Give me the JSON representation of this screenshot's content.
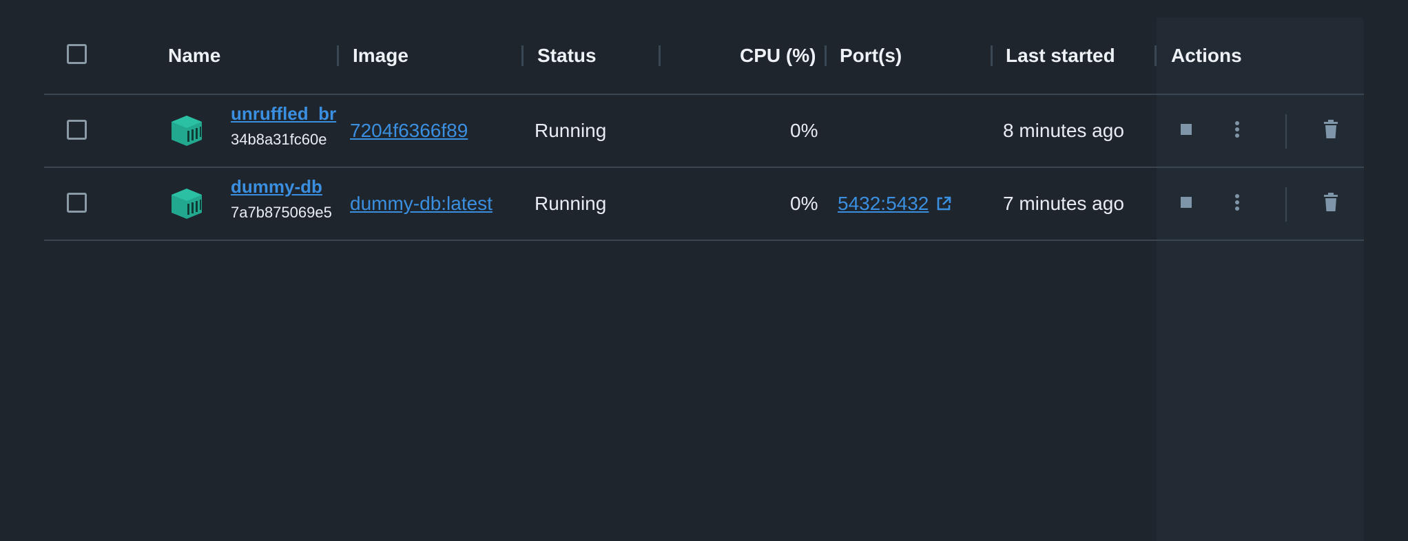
{
  "header": {
    "select_all_checked": false,
    "columns": {
      "name": "Name",
      "image": "Image",
      "status": "Status",
      "cpu": "CPU (%)",
      "ports": "Port(s)",
      "last_started": "Last started",
      "actions": "Actions"
    }
  },
  "containers": [
    {
      "name": "unruffled_br",
      "id": "34b8a31fc60e",
      "image": "7204f6366f89",
      "status": "Running",
      "cpu": "0%",
      "ports": "",
      "last_started": "8 minutes ago"
    },
    {
      "name": "dummy-db",
      "id": "7a7b875069e5",
      "image": "dummy-db:latest",
      "status": "Running",
      "cpu": "0%",
      "ports": "5432:5432",
      "last_started": "7 minutes ago"
    }
  ],
  "icons": {
    "container": "container-icon",
    "stop": "stop-icon",
    "more": "more-vertical-icon",
    "delete": "trash-icon",
    "external": "external-link-icon"
  },
  "colors": {
    "background": "#1e252d",
    "link": "#3b8fe0",
    "container_icon": "#22a88f",
    "action_icon": "#7f95a8"
  }
}
